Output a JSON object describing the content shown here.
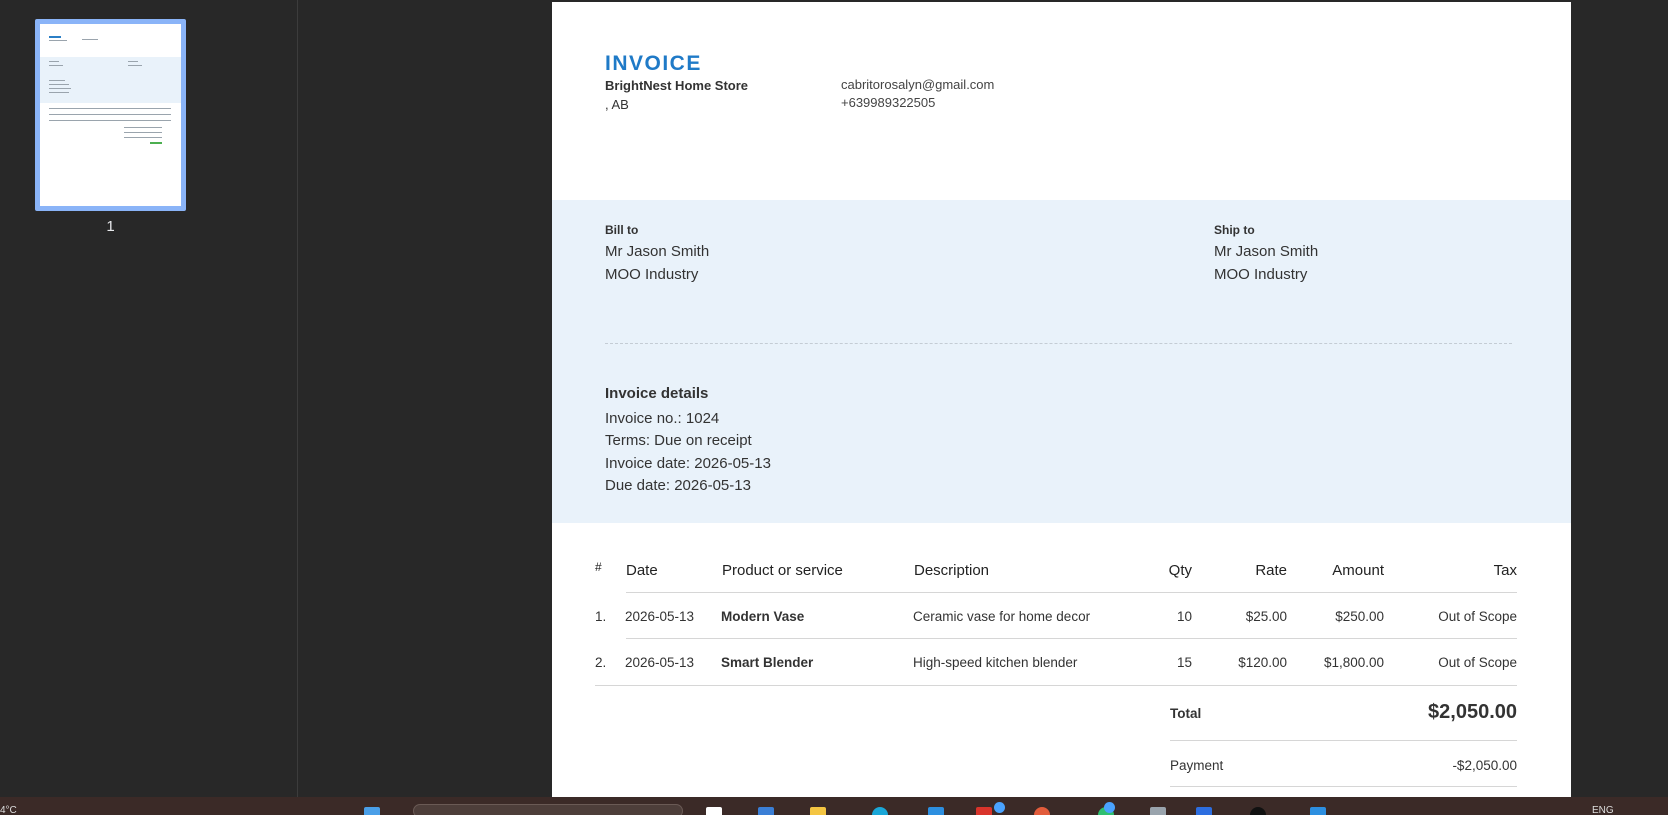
{
  "sidebar": {
    "page_number": "1"
  },
  "invoice": {
    "title": "INVOICE",
    "company_name": "BrightNest Home Store",
    "company_address": ", AB",
    "email": "cabritorosalyn@gmail.com",
    "phone": "+639989322505",
    "bill_to": {
      "label": "Bill to",
      "name": "Mr Jason Smith",
      "company": "MOO Industry"
    },
    "ship_to": {
      "label": "Ship to",
      "name": "Mr Jason Smith",
      "company": "MOO Industry"
    },
    "details": {
      "title": "Invoice details",
      "number": "Invoice no.: 1024",
      "terms": "Terms: Due on receipt",
      "date": "Invoice date: 2026-05-13",
      "due": "Due date: 2026-05-13"
    },
    "table": {
      "headers": {
        "num": "#",
        "date": "Date",
        "product": "Product or service",
        "description": "Description",
        "qty": "Qty",
        "rate": "Rate",
        "amount": "Amount",
        "tax": "Tax"
      },
      "rows": [
        {
          "num": "1.",
          "date": "2026-05-13",
          "product": "Modern Vase",
          "description": "Ceramic vase for home decor",
          "qty": "10",
          "rate": "$25.00",
          "amount": "$250.00",
          "tax": "Out of Scope"
        },
        {
          "num": "2.",
          "date": "2026-05-13",
          "product": "Smart Blender",
          "description": "High-speed kitchen blender",
          "qty": "15",
          "rate": "$120.00",
          "amount": "$1,800.00",
          "tax": "Out of Scope"
        }
      ]
    },
    "total_label": "Total",
    "total_value": "$2,050.00",
    "payment_label": "Payment",
    "payment_value": "-$2,050.00"
  },
  "taskbar": {
    "temperature": "4°C",
    "language": "ENG"
  }
}
